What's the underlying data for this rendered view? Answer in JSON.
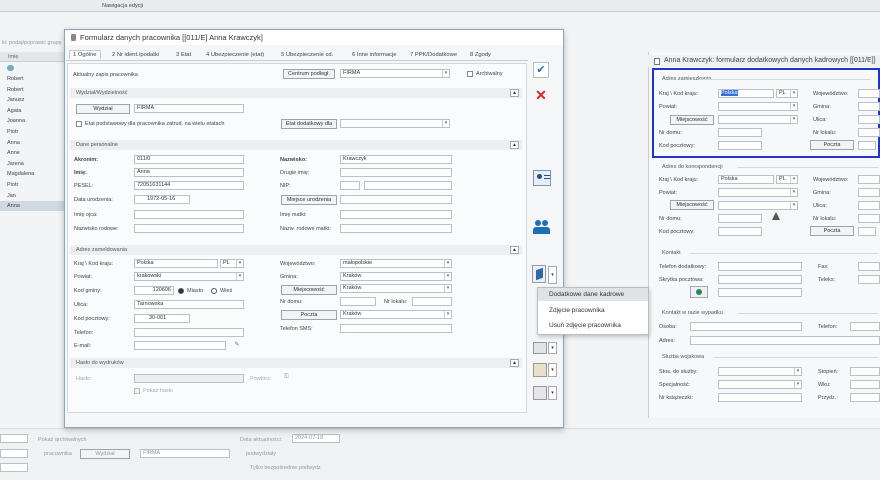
{
  "background": {
    "top_caption": "Nawigacja edycji",
    "filter_hint": "ki: podaj/poprawić grupę",
    "col_header": "Imię",
    "names": [
      "Robert",
      "Robert",
      "Janusz",
      "Agata",
      "Joanna",
      "Piotr",
      "Anna",
      "Anne",
      "Jarena",
      "Magdalena",
      "Piotr",
      "Jan",
      "Anna"
    ],
    "bottom": {
      "show_archived": "Pokaż archiwalnych",
      "date_label": "Data aktualności:",
      "date": "2024-07-18",
      "worker": "pracownika",
      "wydzial": "Wydział",
      "firma": "FIRMA",
      "podwydzial": "podwydziały",
      "only_extra": "Tylko bezpośrednie podwydz"
    }
  },
  "dialog": {
    "title": "Formularz danych pracownika [[011/E] Anna Krawczyk]",
    "tabs": [
      "1 Ogólne",
      "2 Nr ident./podatki",
      "3 Etat",
      "4 Ubezpieczenie (etat)",
      "5 Ubezpieczenie cd.",
      "6 Inne informacje",
      "7 PPK/Dodatkowe",
      "8 Zgody"
    ],
    "current_record_label": "Aktualny zapis pracownika",
    "central_btn": "Centrum podległ.",
    "central_value": "FIRMA",
    "archived_label": "Archiwalny",
    "wydzial_section": "Wydział/Wydzielność",
    "wydzial_btn": "Wydział",
    "wydzial_value": "FIRMA",
    "etat_check": "Etat podstawowy dla pracownika zatrud. na wielu etatach",
    "etat_extra_btn": "Etat dodatkowy dla",
    "personal_section": "Dane personalne",
    "akronim_label": "Akronim:",
    "akronim": "011/0",
    "imie_label": "Imię:",
    "imie": "Anna",
    "pesel_label": "PESEL:",
    "pesel": "72051631144",
    "birth_label": "Data urodzenia:",
    "birth": "1972-05-16",
    "father_label": "Imię ojca:",
    "family_label": "Nazwisko rodowe:",
    "nazwisko_label": "Nazwisko:",
    "nazwisko": "Krawczyk",
    "second_label": "Drugie imię:",
    "nip_label": "NIP:",
    "birthplace_btn": "Miejsce urodzenia",
    "mother_label": "Imię matki:",
    "mother_family_label": "Nazw. rodowe matki:",
    "address_section": "Adres zameldowania",
    "country_label": "Kraj \\ Kod kraju:",
    "country": "Polska",
    "country_code": "PL",
    "county_label": "Powiat:",
    "county": "krakowski",
    "gmina_code_label": "Kod gminy:",
    "gmina_code": "120606",
    "miasto": "Miasto",
    "wies": "Wieś",
    "street_label": "Ulica:",
    "street": "Tarnowska",
    "postal_label": "Kod pocztowy:",
    "postal": "30-001",
    "phone_label": "Telefon:",
    "email_label": "E-mail:",
    "voivodeship_label": "Województwo:",
    "voivodeship": "małopolskie",
    "gmina_label": "Gmina:",
    "gmina": "Kraków",
    "city_btn": "Miejscowość",
    "city": "Kraków",
    "house_label": "Nr domu:",
    "flat_label": "Nr lokalu:",
    "post_btn": "Poczta",
    "post": "Kraków",
    "sms_label": "Telefon SMS:",
    "password_section": "Hasło do wydruków",
    "password_label": "Hasło:",
    "repeat_label": "Powtórz:",
    "show_password": "Pokaż hasło"
  },
  "context_menu": {
    "items": [
      "Dodatkowe dane kadrowe",
      "Zdjęcie pracownika",
      "Usuń zdjęcie pracownika"
    ]
  },
  "right_panel": {
    "title": "Anna Krawczyk: formularz dodatkowych danych kadrowych [[011/E]]",
    "residence_section": "Adres zamieszkania",
    "country_label": "Kraj \\ Kod kraju:",
    "country": "Polska",
    "code": "PL",
    "county_label": "Powiat:",
    "city_btn": "Miejscowość",
    "house_label": "Nr domu:",
    "postal_label": "Kod pocztowy:",
    "voiv_label": "Województwo:",
    "gmina_label": "Gmina:",
    "street_label": "Ulica:",
    "flat_label": "Nr lokalu:",
    "post_btn": "Poczta",
    "corr_section": "Adres do korespondencji",
    "contact_section": "Kontakt",
    "phone_extra": "Telefon dodatkowy:",
    "mailbox": "Skrytka pocztowa:",
    "fax": "Fax:",
    "teleks": "Teleks:",
    "accident_section": "Kontakt w razie wypadku",
    "person_label": "Osoba:",
    "phone_label": "Telefon:",
    "address_label": "Adres:",
    "military_section": "Służba wojskowa",
    "stos": "Stos. do służby:",
    "spec": "Specjalność:",
    "book": "Nr książeczki:",
    "rank": "Stopień:",
    "wku": "Wku:",
    "przydz": "Przydz.:"
  }
}
